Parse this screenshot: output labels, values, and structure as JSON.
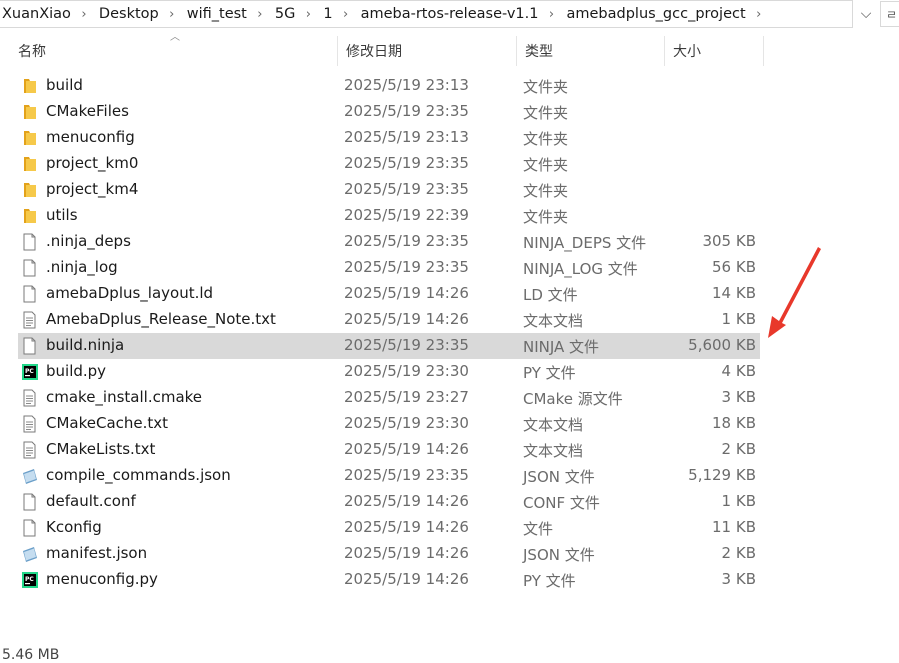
{
  "breadcrumb": [
    "XuanXiao",
    "Desktop",
    "wifi_test",
    "5G",
    "1",
    "ameba-rtos-release-v1.1",
    "amebadplus_gcc_project"
  ],
  "address_dropdown_glyph": "chevron-down-icon",
  "refresh_glyph": "ㄹ",
  "columns": {
    "name": "名称",
    "date": "修改日期",
    "type": "类型",
    "size": "大小"
  },
  "files": [
    {
      "name": "build",
      "date": "2025/5/19 23:13",
      "type": "文件夹",
      "size": "",
      "icon": "folder-icon"
    },
    {
      "name": "CMakeFiles",
      "date": "2025/5/19 23:35",
      "type": "文件夹",
      "size": "",
      "icon": "folder-icon"
    },
    {
      "name": "menuconfig",
      "date": "2025/5/19 23:13",
      "type": "文件夹",
      "size": "",
      "icon": "folder-icon"
    },
    {
      "name": "project_km0",
      "date": "2025/5/19 23:35",
      "type": "文件夹",
      "size": "",
      "icon": "folder-icon"
    },
    {
      "name": "project_km4",
      "date": "2025/5/19 23:35",
      "type": "文件夹",
      "size": "",
      "icon": "folder-icon"
    },
    {
      "name": "utils",
      "date": "2025/5/19 22:39",
      "type": "文件夹",
      "size": "",
      "icon": "folder-icon"
    },
    {
      "name": ".ninja_deps",
      "date": "2025/5/19 23:35",
      "type": "NINJA_DEPS 文件",
      "size": "305 KB",
      "icon": "file-icon"
    },
    {
      "name": ".ninja_log",
      "date": "2025/5/19 23:35",
      "type": "NINJA_LOG 文件",
      "size": "56 KB",
      "icon": "file-icon"
    },
    {
      "name": "amebaDplus_layout.ld",
      "date": "2025/5/19 14:26",
      "type": "LD 文件",
      "size": "14 KB",
      "icon": "file-icon"
    },
    {
      "name": "AmebaDplus_Release_Note.txt",
      "date": "2025/5/19 14:26",
      "type": "文本文档",
      "size": "1 KB",
      "icon": "text-file-icon"
    },
    {
      "name": "build.ninja",
      "date": "2025/5/19 23:35",
      "type": "NINJA 文件",
      "size": "5,600 KB",
      "icon": "file-icon",
      "selected": true
    },
    {
      "name": "build.py",
      "date": "2025/5/19 23:30",
      "type": "PY 文件",
      "size": "4 KB",
      "icon": "pycharm-icon"
    },
    {
      "name": "cmake_install.cmake",
      "date": "2025/5/19 23:27",
      "type": "CMake 源文件",
      "size": "3 KB",
      "icon": "text-file-icon"
    },
    {
      "name": "CMakeCache.txt",
      "date": "2025/5/19 23:30",
      "type": "文本文档",
      "size": "18 KB",
      "icon": "text-file-icon"
    },
    {
      "name": "CMakeLists.txt",
      "date": "2025/5/19 14:26",
      "type": "文本文档",
      "size": "2 KB",
      "icon": "text-file-icon"
    },
    {
      "name": "compile_commands.json",
      "date": "2025/5/19 23:35",
      "type": "JSON 文件",
      "size": "5,129 KB",
      "icon": "json-icon"
    },
    {
      "name": "default.conf",
      "date": "2025/5/19 14:26",
      "type": "CONF 文件",
      "size": "1 KB",
      "icon": "file-icon"
    },
    {
      "name": "Kconfig",
      "date": "2025/5/19 14:26",
      "type": "文件",
      "size": "11 KB",
      "icon": "file-icon"
    },
    {
      "name": "manifest.json",
      "date": "2025/5/19 14:26",
      "type": "JSON 文件",
      "size": "2 KB",
      "icon": "json-icon"
    },
    {
      "name": "menuconfig.py",
      "date": "2025/5/19 14:26",
      "type": "PY 文件",
      "size": "3 KB",
      "icon": "pycharm-icon"
    }
  ],
  "status_bar": {
    "selection_size": "5.46 MB"
  },
  "colors": {
    "folder": "#f2c03c",
    "selection": "#d9d9d9",
    "annotation_arrow": "#e8382b"
  }
}
